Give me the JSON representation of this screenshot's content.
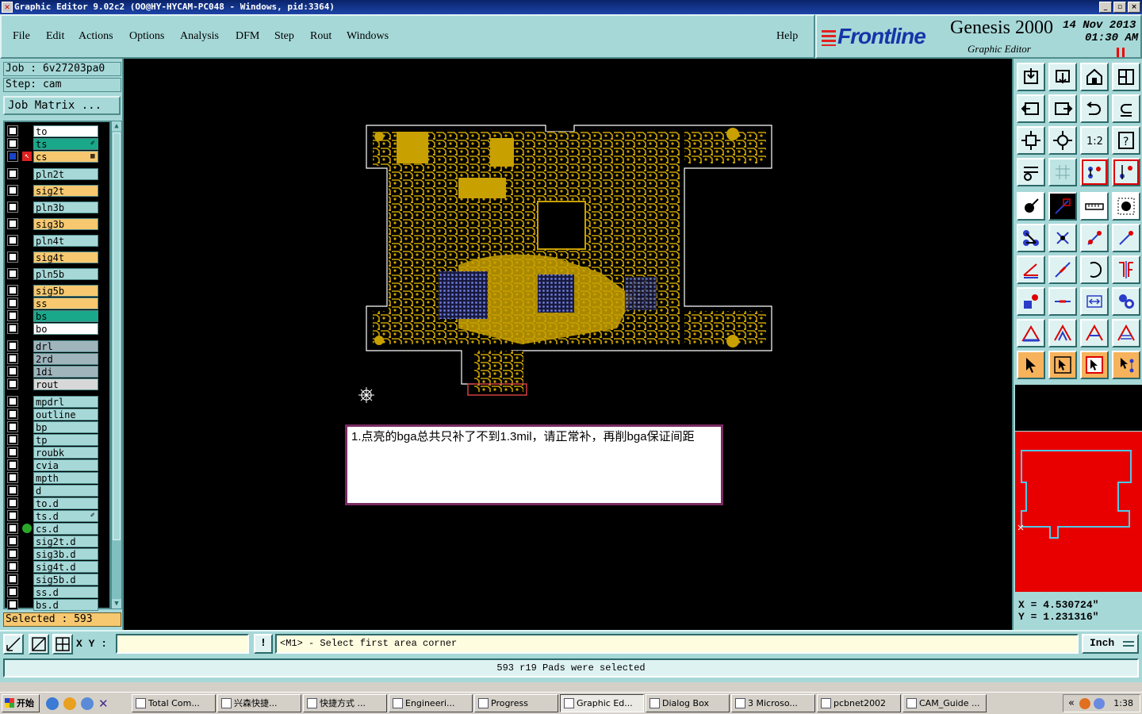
{
  "window": {
    "title": "Graphic Editor 9.02c2  (OO@HY-HYCAM-PC048 - Windows, pid:3364)",
    "controls": [
      "_",
      "▫",
      "×"
    ]
  },
  "menu": {
    "items": [
      "File",
      "Edit",
      "Actions",
      "Options",
      "Analysis",
      "DFM",
      "Step",
      "Rout",
      "Windows"
    ],
    "help": "Help"
  },
  "brand": {
    "logo": "Frontline",
    "product": "Genesis 2000",
    "subtitle": "Graphic Editor",
    "date": "14 Nov 2013",
    "time": "01:30 AM"
  },
  "job": {
    "job_label": "Job : 6v27203pa0",
    "step_label": "Step: cam",
    "matrix_button": "Job Matrix ..."
  },
  "layers": [
    {
      "name": "to",
      "color": "#ffffff",
      "tag": ""
    },
    {
      "name": "ts",
      "color": "#1aa88a",
      "tag": "✐"
    },
    {
      "name": "cs",
      "color": "#f7c870",
      "tag": "▦",
      "work": true
    },
    {
      "name": "pln2t",
      "color": "#a7d8d8",
      "tag": ""
    },
    {
      "name": "sig2t",
      "color": "#f7c870",
      "tag": ""
    },
    {
      "name": "pln3b",
      "color": "#a7d8d8",
      "tag": ""
    },
    {
      "name": "sig3b",
      "color": "#f7c870",
      "tag": ""
    },
    {
      "name": "pln4t",
      "color": "#a7d8d8",
      "tag": ""
    },
    {
      "name": "sig4t",
      "color": "#f7c870",
      "tag": ""
    },
    {
      "name": "pln5b",
      "color": "#a7d8d8",
      "tag": ""
    },
    {
      "name": "sig5b",
      "color": "#f7c870",
      "tag": ""
    },
    {
      "name": "ss",
      "color": "#f7c870",
      "tag": ""
    },
    {
      "name": "bs",
      "color": "#1aa88a",
      "tag": ""
    },
    {
      "name": "bo",
      "color": "#ffffff",
      "tag": ""
    },
    {
      "name": "drl",
      "color": "#a0b4bc",
      "tag": ""
    },
    {
      "name": "2rd",
      "color": "#a0b4bc",
      "tag": ""
    },
    {
      "name": "1di",
      "color": "#a0b4bc",
      "tag": ""
    },
    {
      "name": "rout",
      "color": "#d8d8d8",
      "tag": ""
    },
    {
      "name": "mpdrl",
      "color": "#a7d8d8",
      "tag": ""
    },
    {
      "name": "outline",
      "color": "#a7d8d8",
      "tag": ""
    },
    {
      "name": "bp",
      "color": "#a7d8d8",
      "tag": ""
    },
    {
      "name": "tp",
      "color": "#a7d8d8",
      "tag": ""
    },
    {
      "name": "roubk",
      "color": "#a7d8d8",
      "tag": ""
    },
    {
      "name": "cvia",
      "color": "#a7d8d8",
      "tag": ""
    },
    {
      "name": "mpth",
      "color": "#a7d8d8",
      "tag": ""
    },
    {
      "name": "d",
      "color": "#a7d8d8",
      "tag": ""
    },
    {
      "name": "to.d",
      "color": "#a7d8d8",
      "tag": ""
    },
    {
      "name": "ts.d",
      "color": "#a7d8d8",
      "tag": "✐"
    },
    {
      "name": "cs.d",
      "color": "#a7d8d8",
      "tag": "",
      "dot": true
    },
    {
      "name": "sig2t.d",
      "color": "#a7d8d8",
      "tag": ""
    },
    {
      "name": "sig3b.d",
      "color": "#a7d8d8",
      "tag": ""
    },
    {
      "name": "sig4t.d",
      "color": "#a7d8d8",
      "tag": ""
    },
    {
      "name": "sig5b.d",
      "color": "#a7d8d8",
      "tag": ""
    },
    {
      "name": "ss.d",
      "color": "#a7d8d8",
      "tag": ""
    },
    {
      "name": "bs.d",
      "color": "#a7d8d8",
      "tag": ""
    }
  ],
  "selected_label": "Selected : 593",
  "note": "1.点亮的bga总共只补了不到1.3mil，请正常补，再削bga保证间距",
  "coords": {
    "x": "X = 4.530724\"",
    "y": "Y = 1.231316\""
  },
  "cmd": {
    "xy_label": "X Y :",
    "xy_value": "",
    "info": "!",
    "prompt": "<M1> - Select first area corner",
    "unit": "Inch"
  },
  "status": "593 r19 Pads were selected",
  "taskbar": {
    "start": "开始",
    "tasks": [
      {
        "label": "Total Com...",
        "active": false
      },
      {
        "label": "兴森快捷...",
        "active": false
      },
      {
        "label": "快捷方式 ...",
        "active": false
      },
      {
        "label": "Engineeri...",
        "active": false
      },
      {
        "label": "Progress",
        "active": false
      },
      {
        "label": "Graphic Ed...",
        "active": true
      },
      {
        "label": "Dialog Box",
        "active": false
      },
      {
        "label": "3 Microso...",
        "active": false
      },
      {
        "label": "pcbnet2002",
        "active": false
      },
      {
        "label": "CAM_Guide ...",
        "active": false
      }
    ],
    "clock": "1:38"
  },
  "colors": {
    "panel": "#a7d8d8",
    "copper": "#c8a000",
    "board_outline": "#ffffff",
    "bga_highlight": "#5a6ec8",
    "minimap_bg": "#e80000",
    "minimap_outline": "#4fc8e8"
  }
}
